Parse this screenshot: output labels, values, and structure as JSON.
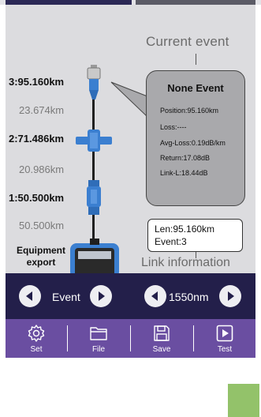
{
  "diagram": {
    "current_event_title": "Current event",
    "link_info_title": "Link information",
    "equipment_label": [
      "Equipment",
      "export"
    ],
    "events": [
      {
        "label": "3:95.160km"
      },
      {
        "label": "2:71.486km"
      },
      {
        "label": "1:50.500km"
      }
    ],
    "segments": [
      {
        "label": "23.674km"
      },
      {
        "label": "20.986km"
      },
      {
        "label": "50.500km"
      }
    ]
  },
  "event_panel": {
    "title": "None Event",
    "position": "Position:95.160km",
    "loss": "Loss:----",
    "avg_loss": "Avg-Loss:0.19dB/km",
    "return": "Return:17.08dB",
    "link_l": "Link-L:18.44dB"
  },
  "link_info": {
    "len": "Len:95.160km",
    "event": "Event:3"
  },
  "navigation": {
    "event_label": "Event",
    "wavelength_label": "1550nm"
  },
  "toolbar": {
    "set_label": "Set",
    "file_label": "File",
    "save_label": "Save",
    "test_label": "Test"
  },
  "colors": {
    "nav_background": "#231f4a",
    "toolbar_background": "#6a4ea1",
    "screen_background": "#dcdcdf",
    "bubble_background": "#a9a9ac",
    "connector_blue": "#3b7fd0",
    "corner_green": "#93c26a"
  },
  "icons": [
    "gear-icon",
    "folder-icon",
    "save-icon",
    "play-icon",
    "arrow-left-icon",
    "arrow-right-icon"
  ]
}
